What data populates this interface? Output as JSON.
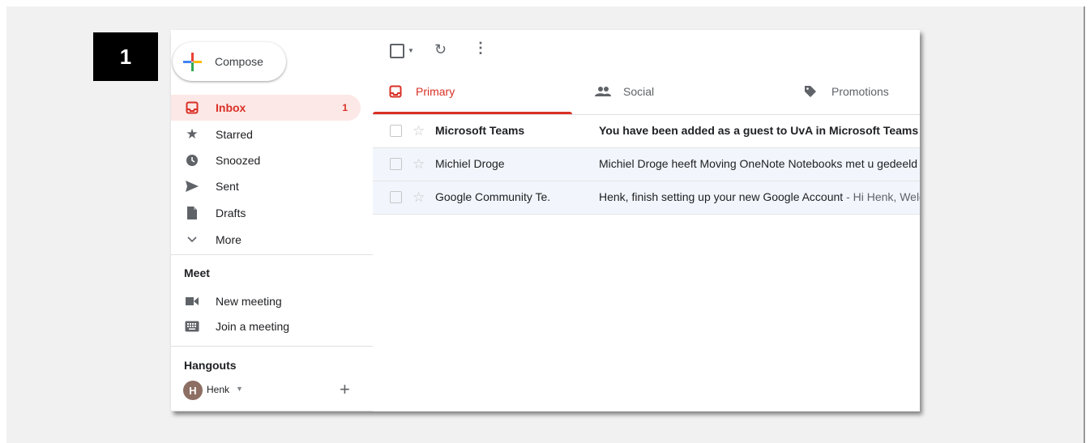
{
  "step_badge": "1",
  "compose": {
    "label": "Compose"
  },
  "nav": [
    {
      "label": "Inbox",
      "count": "1",
      "icon": "inbox-icon",
      "active": true
    },
    {
      "label": "Starred",
      "icon": "star-icon"
    },
    {
      "label": "Snoozed",
      "icon": "clock-icon"
    },
    {
      "label": "Sent",
      "icon": "send-icon"
    },
    {
      "label": "Drafts",
      "icon": "draft-icon"
    },
    {
      "label": "More",
      "icon": "chevron-down-icon"
    }
  ],
  "meet": {
    "title": "Meet",
    "items": [
      {
        "label": "New meeting",
        "icon": "video-camera-icon"
      },
      {
        "label": "Join a meeting",
        "icon": "keyboard-icon"
      }
    ]
  },
  "hangouts": {
    "title": "Hangouts",
    "user": "Henk",
    "avatar_letter": "H",
    "add": "+"
  },
  "tabs": [
    {
      "label": "Primary",
      "icon": "inbox-icon",
      "active": true
    },
    {
      "label": "Social",
      "icon": "people-icon"
    },
    {
      "label": "Promotions",
      "icon": "tag-icon"
    }
  ],
  "emails": [
    {
      "sender": "Microsoft Teams",
      "subject": "You have been added as a guest to UvA in Microsoft Teams",
      "snippet": " - ",
      "unread": true
    },
    {
      "sender": "Michiel Droge",
      "subject": "Michiel Droge heeft Moving OneNote Notebooks met u gedeeld",
      "snippet": "",
      "unread": false
    },
    {
      "sender": "Google Community Te.",
      "subject": "Henk, finish setting up your new Google Account",
      "snippet": " - Hi Henk, Welcome",
      "unread": false
    }
  ],
  "colors": {
    "accent": "#d93025",
    "active_bg": "#fce8e6",
    "read_row_bg": "#f2f6fc"
  }
}
